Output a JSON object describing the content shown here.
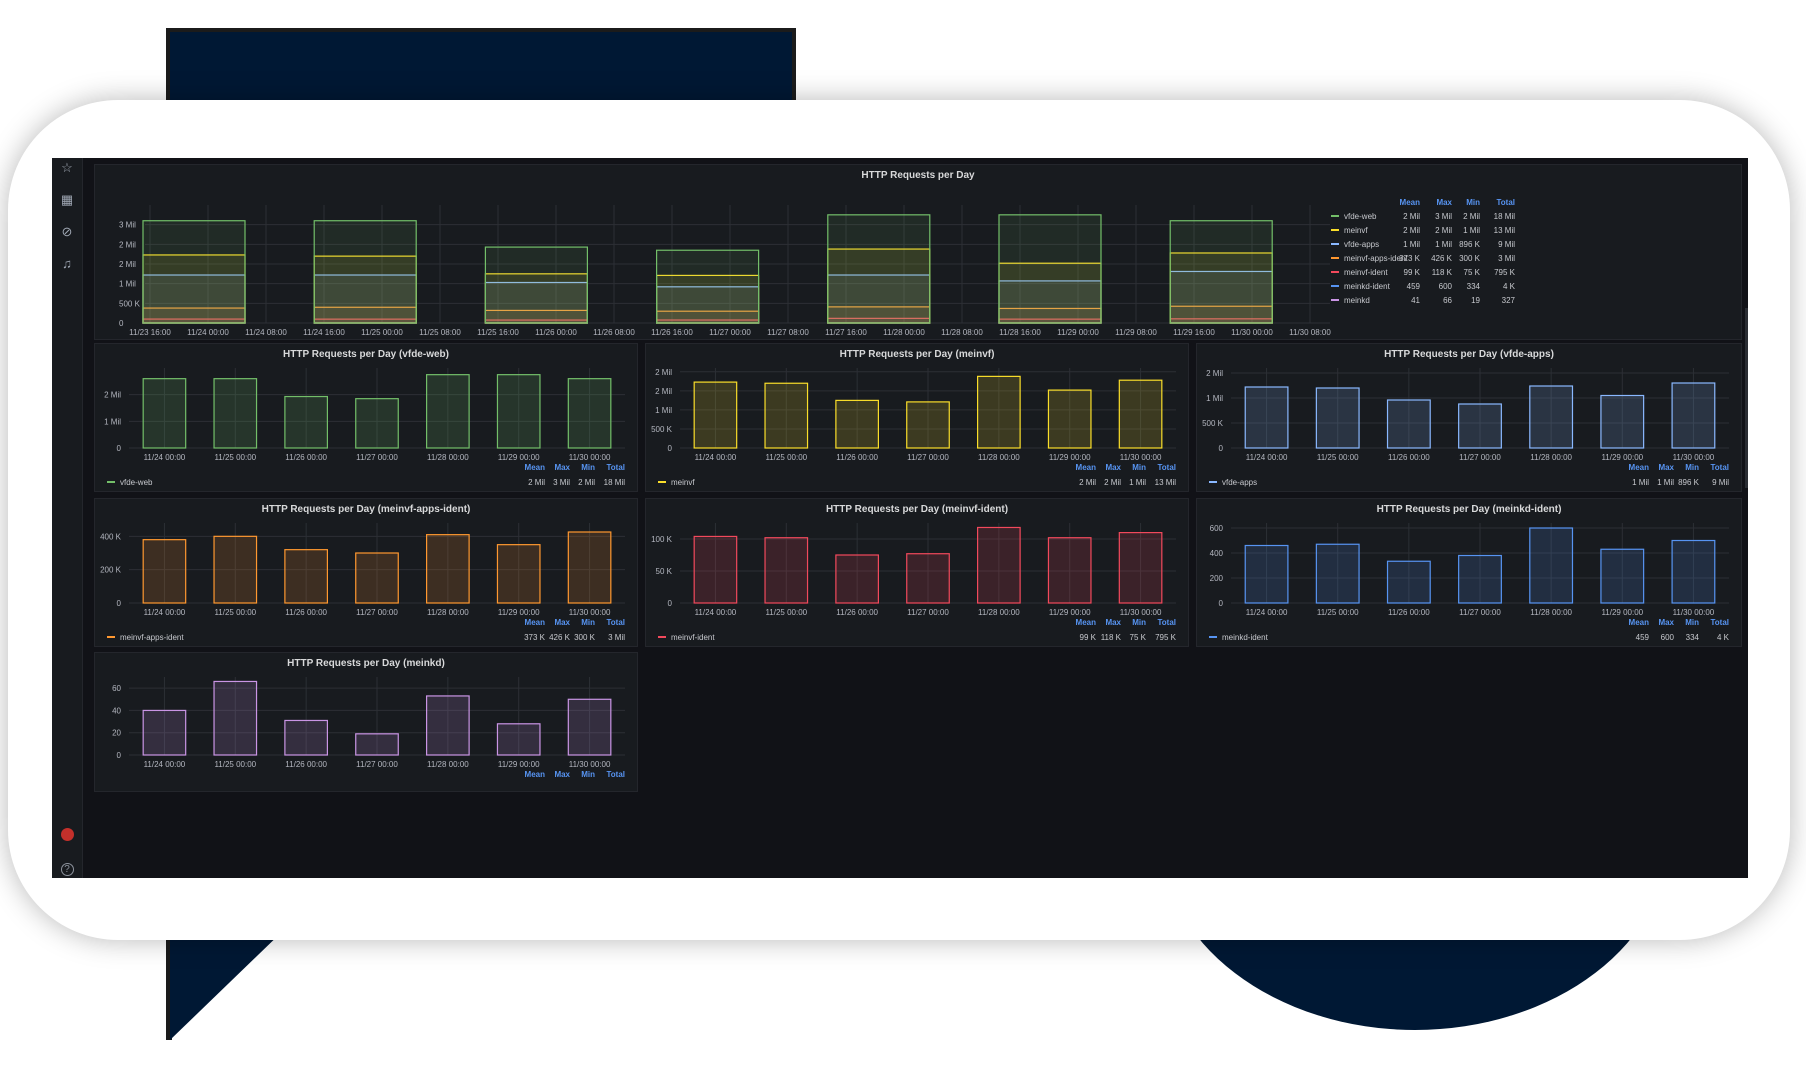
{
  "colors": {
    "vfde-web": "#73bf69",
    "meinvf": "#fade2a",
    "vfde-apps": "#8ab8ff",
    "meinvf-apps-ident": "#ff9830",
    "meinvf-ident": "#f2495c",
    "meinkd-ident": "#5794f2",
    "meinkd": "#ca95e5"
  },
  "sidebar": {
    "icons": [
      "star-icon",
      "dashboards-icon",
      "explore-icon",
      "alerting-icon"
    ],
    "bottom_icons": [
      "user-avatar-icon",
      "help-icon"
    ]
  },
  "stat_headers": [
    "Mean",
    "Max",
    "Min",
    "Total"
  ],
  "main_panel": {
    "title": "HTTP Requests per Day",
    "y_ticks": [
      "0",
      "500 K",
      "1 Mil",
      "2 Mil",
      "2 Mil",
      "3 Mil"
    ],
    "x_ticks": [
      "11/23 16:00",
      "11/24 00:00",
      "11/24 08:00",
      "11/24 16:00",
      "11/25 00:00",
      "11/25 08:00",
      "11/25 16:00",
      "11/26 00:00",
      "11/26 08:00",
      "11/26 16:00",
      "11/27 00:00",
      "11/27 08:00",
      "11/27 16:00",
      "11/28 00:00",
      "11/28 08:00",
      "11/28 16:00",
      "11/29 00:00",
      "11/29 08:00",
      "11/29 16:00",
      "11/30 00:00",
      "11/30 08:00"
    ],
    "legend": [
      {
        "name": "vfde-web",
        "mean": "2 Mil",
        "max": "3 Mil",
        "min": "2 Mil",
        "total": "18 Mil"
      },
      {
        "name": "meinvf",
        "mean": "2 Mil",
        "max": "2 Mil",
        "min": "1 Mil",
        "total": "13 Mil"
      },
      {
        "name": "vfde-apps",
        "mean": "1 Mil",
        "max": "1 Mil",
        "min": "896 K",
        "total": "9 Mil"
      },
      {
        "name": "meinvf-apps-ident",
        "mean": "373 K",
        "max": "426 K",
        "min": "300 K",
        "total": "3 Mil"
      },
      {
        "name": "meinvf-ident",
        "mean": "99 K",
        "max": "118 K",
        "min": "75 K",
        "total": "795 K"
      },
      {
        "name": "meinkd-ident",
        "mean": "459",
        "max": "600",
        "min": "334",
        "total": "4 K"
      },
      {
        "name": "meinkd",
        "mean": "41",
        "max": "66",
        "min": "19",
        "total": "327"
      }
    ]
  },
  "chart_data": [
    {
      "type": "bar",
      "title": "HTTP Requests per Day",
      "stacked": true,
      "categories": [
        "11/24 00:00",
        "11/25 00:00",
        "11/26 00:00",
        "11/27 00:00",
        "11/28 00:00",
        "11/29 00:00",
        "11/30 00:00"
      ],
      "series": [
        {
          "name": "meinkd",
          "values": [
            40,
            66,
            31,
            19,
            53,
            28,
            50
          ]
        },
        {
          "name": "meinkd-ident",
          "values": [
            460,
            470,
            340,
            380,
            600,
            430,
            500
          ]
        },
        {
          "name": "meinvf-ident",
          "values": [
            100000,
            98000,
            75000,
            76000,
            118000,
            98000,
            106000
          ]
        },
        {
          "name": "meinvf-apps-ident",
          "values": [
            380000,
            400000,
            320000,
            300000,
            410000,
            370000,
            426000
          ]
        },
        {
          "name": "vfde-apps",
          "values": [
            1220000,
            1220000,
            1030000,
            920000,
            1220000,
            1070000,
            1310000
          ]
        },
        {
          "name": "meinvf",
          "values": [
            1730000,
            1700000,
            1250000,
            1210000,
            1880000,
            1520000,
            1780000
          ]
        },
        {
          "name": "vfde-web",
          "values": [
            2600000,
            2600000,
            1930000,
            1850000,
            2750000,
            2750000,
            2600000
          ]
        }
      ],
      "ylim": [
        0,
        3000000
      ]
    },
    {
      "type": "bar",
      "title": "HTTP Requests per Day (vfde-web)",
      "categories": [
        "11/24 00:00",
        "11/25 00:00",
        "11/26 00:00",
        "11/27 00:00",
        "11/28 00:00",
        "11/29 00:00",
        "11/30 00:00"
      ],
      "series": [
        {
          "name": "vfde-web",
          "values": [
            2600000,
            2600000,
            1930000,
            1850000,
            2750000,
            2750000,
            2600000
          ]
        }
      ],
      "y_ticks": [
        [
          0,
          "0"
        ],
        [
          1000000,
          "1 Mil"
        ],
        [
          2000000,
          "2 Mil"
        ]
      ],
      "ylim": [
        0,
        3000000
      ],
      "stats": {
        "mean": "2 Mil",
        "max": "3 Mil",
        "min": "2 Mil",
        "total": "18 Mil"
      }
    },
    {
      "type": "bar",
      "title": "HTTP Requests per Day (meinvf)",
      "categories": [
        "11/24 00:00",
        "11/25 00:00",
        "11/26 00:00",
        "11/27 00:00",
        "11/28 00:00",
        "11/29 00:00",
        "11/30 00:00"
      ],
      "series": [
        {
          "name": "meinvf",
          "values": [
            1730000,
            1700000,
            1250000,
            1210000,
            1880000,
            1520000,
            1780000
          ]
        }
      ],
      "y_ticks": [
        [
          0,
          "0"
        ],
        [
          500000,
          "500 K"
        ],
        [
          1000000,
          "1 Mil"
        ],
        [
          1500000,
          "2 Mil"
        ],
        [
          2000000,
          "2 Mil"
        ]
      ],
      "ylim": [
        0,
        2100000
      ],
      "stats": {
        "mean": "2 Mil",
        "max": "2 Mil",
        "min": "1 Mil",
        "total": "13 Mil"
      }
    },
    {
      "type": "bar",
      "title": "HTTP Requests per Day (vfde-apps)",
      "categories": [
        "11/24 00:00",
        "11/25 00:00",
        "11/26 00:00",
        "11/27 00:00",
        "11/28 00:00",
        "11/29 00:00",
        "11/30 00:00"
      ],
      "series": [
        {
          "name": "vfde-apps",
          "values": [
            1220000,
            1200000,
            960000,
            880000,
            1240000,
            1050000,
            1300000
          ]
        }
      ],
      "y_ticks": [
        [
          0,
          "0"
        ],
        [
          500000,
          "500 K"
        ],
        [
          1000000,
          "1 Mil"
        ],
        [
          1500000,
          "2 Mil"
        ]
      ],
      "ylim": [
        0,
        1600000
      ],
      "stats": {
        "mean": "1 Mil",
        "max": "1 Mil",
        "min": "896 K",
        "total": "9 Mil"
      }
    },
    {
      "type": "bar",
      "title": "HTTP Requests per Day (meinvf-apps-ident)",
      "categories": [
        "11/24 00:00",
        "11/25 00:00",
        "11/26 00:00",
        "11/27 00:00",
        "11/28 00:00",
        "11/29 00:00",
        "11/30 00:00"
      ],
      "series": [
        {
          "name": "meinvf-apps-ident",
          "values": [
            380000,
            400000,
            320000,
            300000,
            410000,
            350000,
            426000
          ]
        }
      ],
      "y_ticks": [
        [
          0,
          "0"
        ],
        [
          200000,
          "200 K"
        ],
        [
          400000,
          "400 K"
        ]
      ],
      "ylim": [
        0,
        480000
      ],
      "stats": {
        "mean": "373 K",
        "max": "426 K",
        "min": "300 K",
        "total": "3 Mil"
      }
    },
    {
      "type": "bar",
      "title": "HTTP Requests per Day (meinvf-ident)",
      "categories": [
        "11/24 00:00",
        "11/25 00:00",
        "11/26 00:00",
        "11/27 00:00",
        "11/28 00:00",
        "11/29 00:00",
        "11/30 00:00"
      ],
      "series": [
        {
          "name": "meinvf-ident",
          "values": [
            104000,
            102000,
            75000,
            77000,
            118000,
            102000,
            110000
          ]
        }
      ],
      "y_ticks": [
        [
          0,
          "0"
        ],
        [
          50000,
          "50 K"
        ],
        [
          100000,
          "100 K"
        ]
      ],
      "ylim": [
        0,
        125000
      ],
      "stats": {
        "mean": "99 K",
        "max": "118 K",
        "min": "75 K",
        "total": "795 K"
      }
    },
    {
      "type": "bar",
      "title": "HTTP Requests per Day (meinkd-ident)",
      "categories": [
        "11/24 00:00",
        "11/25 00:00",
        "11/26 00:00",
        "11/27 00:00",
        "11/28 00:00",
        "11/29 00:00",
        "11/30 00:00"
      ],
      "series": [
        {
          "name": "meinkd-ident",
          "values": [
            460,
            470,
            334,
            380,
            600,
            430,
            500
          ]
        }
      ],
      "y_ticks": [
        [
          0,
          "0"
        ],
        [
          200,
          "200"
        ],
        [
          400,
          "400"
        ],
        [
          600,
          "600"
        ]
      ],
      "ylim": [
        0,
        640
      ],
      "stats": {
        "mean": "459",
        "max": "600",
        "min": "334",
        "total": "4 K"
      }
    },
    {
      "type": "bar",
      "title": "HTTP Requests per Day (meinkd)",
      "categories": [
        "11/24 00:00",
        "11/25 00:00",
        "11/26 00:00",
        "11/27 00:00",
        "11/28 00:00",
        "11/29 00:00",
        "11/30 00:00"
      ],
      "series": [
        {
          "name": "meinkd",
          "values": [
            40,
            66,
            31,
            19,
            53,
            28,
            50
          ]
        }
      ],
      "y_ticks": [
        [
          0,
          "0"
        ],
        [
          20,
          "20"
        ],
        [
          40,
          "40"
        ],
        [
          60,
          "60"
        ]
      ],
      "ylim": [
        0,
        70
      ],
      "stats": null
    }
  ]
}
